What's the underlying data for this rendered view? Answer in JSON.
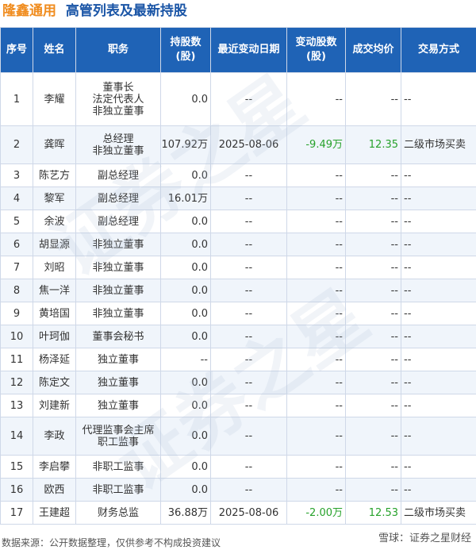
{
  "title": {
    "company": "隆鑫通用",
    "heading": "高管列表及最新持股"
  },
  "columns": [
    "序号",
    "姓名",
    "职务",
    "持股数\n(股)",
    "最近变动日期",
    "变动股数\n(股)",
    "成交均价",
    "交易方式"
  ],
  "rows": [
    [
      "1",
      "李耀",
      "董事长\n法定代表人\n非独立董事",
      "0.0",
      "--",
      "--",
      "--",
      "--"
    ],
    [
      "2",
      "龚晖",
      "总经理\n非独立董事",
      "107.92万",
      "2025-08-06",
      "-9.49万",
      "12.35",
      "二级市场买卖"
    ],
    [
      "3",
      "陈艺方",
      "副总经理",
      "0.0",
      "--",
      "--",
      "--",
      "--"
    ],
    [
      "4",
      "黎军",
      "副总经理",
      "16.01万",
      "--",
      "--",
      "--",
      "--"
    ],
    [
      "5",
      "余波",
      "副总经理",
      "0.0",
      "--",
      "--",
      "--",
      "--"
    ],
    [
      "6",
      "胡显源",
      "非独立董事",
      "0.0",
      "--",
      "--",
      "--",
      "--"
    ],
    [
      "7",
      "刘昭",
      "非独立董事",
      "0.0",
      "--",
      "--",
      "--",
      "--"
    ],
    [
      "8",
      "焦一洋",
      "非独立董事",
      "0.0",
      "--",
      "--",
      "--",
      "--"
    ],
    [
      "9",
      "黄培国",
      "非独立董事",
      "0.0",
      "--",
      "--",
      "--",
      "--"
    ],
    [
      "10",
      "叶珂伽",
      "董事会秘书",
      "0.0",
      "--",
      "--",
      "--",
      "--"
    ],
    [
      "11",
      "杨泽延",
      "独立董事",
      "--",
      "--",
      "--",
      "--",
      "--"
    ],
    [
      "12",
      "陈定文",
      "独立董事",
      "0.0",
      "--",
      "--",
      "--",
      "--"
    ],
    [
      "13",
      "刘建新",
      "独立董事",
      "0.0",
      "--",
      "--",
      "--",
      "--"
    ],
    [
      "14",
      "李政",
      "代理监事会主席\n职工监事",
      "0.0",
      "--",
      "--",
      "--",
      "--"
    ],
    [
      "15",
      "李启攀",
      "非职工监事",
      "0.0",
      "--",
      "--",
      "--",
      "--"
    ],
    [
      "16",
      "欧西",
      "非职工监事",
      "0.0",
      "--",
      "--",
      "--",
      "--"
    ],
    [
      "17",
      "王建超",
      "财务总监",
      "36.88万",
      "2025-08-06",
      "-2.00万",
      "12.53",
      "二级市场买卖"
    ]
  ],
  "footer": {
    "source": "数据来源：公开数据整理，仅供参考不构成投资建议",
    "brand": "雪球：证券之星财经"
  },
  "colors": {
    "header_bg": "#1f63b6",
    "company": "#f08c1e",
    "heading": "#1a55a6",
    "change_color": "#27a22b"
  }
}
